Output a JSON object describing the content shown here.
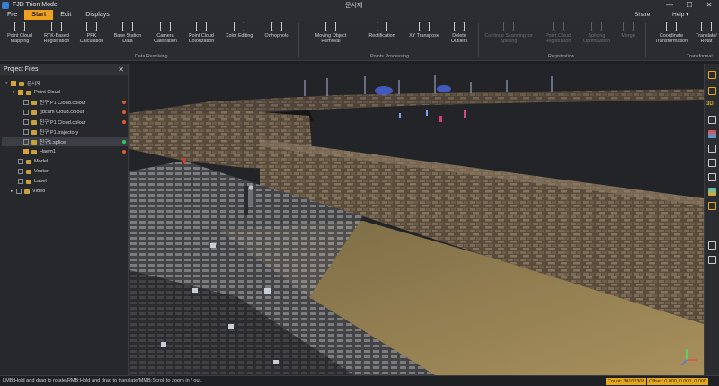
{
  "app": {
    "title": "FJD Trion Model",
    "document_title": "문서제"
  },
  "window_controls": {
    "minimize": "—",
    "maximize": "☐",
    "close": "✕"
  },
  "menu": {
    "items": [
      {
        "label": "File",
        "active": false
      },
      {
        "label": "Start",
        "active": true
      },
      {
        "label": "Edit",
        "active": false
      },
      {
        "label": "Displays",
        "active": false
      }
    ],
    "share": "Share",
    "help": "Help ▾"
  },
  "ribbon": {
    "buttons": [
      {
        "line1": "Point Cloud",
        "line2": "Mapping",
        "icon": "mapping-icon",
        "enabled": true
      },
      {
        "line1": "RTK-Based",
        "line2": "Registration",
        "icon": "rtk-icon",
        "enabled": true
      },
      {
        "line1": "PPK",
        "line2": "Calculation",
        "icon": "ppk-icon",
        "enabled": true
      },
      {
        "line1": "Base Station",
        "line2": "Data",
        "icon": "base-station-icon",
        "enabled": true
      },
      {
        "line1": "Camera",
        "line2": "Calibration",
        "icon": "camera-icon",
        "enabled": true
      },
      {
        "line1": "Point Cloud",
        "line2": "Colorization",
        "icon": "palette-icon",
        "enabled": true
      },
      {
        "line1": "Color Editing",
        "line2": "",
        "icon": "color-edit-icon",
        "enabled": true
      },
      {
        "line1": "Orthophoto",
        "line2": "",
        "icon": "orthophoto-icon",
        "enabled": true
      },
      {
        "line1": "Moving Object",
        "line2": "Removal",
        "icon": "moving-object-icon",
        "enabled": true
      },
      {
        "line1": "Rectification",
        "line2": "",
        "icon": "rectification-icon",
        "enabled": true
      },
      {
        "line1": "XY Transpose",
        "line2": "",
        "icon": "transpose-icon",
        "enabled": true
      },
      {
        "line1": "Delete",
        "line2": "Outliers",
        "icon": "delete-outliers-icon",
        "enabled": true
      },
      {
        "line1": "Continue Scanning for",
        "line2": "Splicing",
        "icon": "continue-scan-icon",
        "enabled": false
      },
      {
        "line1": "Point Cloud",
        "line2": "Registration",
        "icon": "registration-icon",
        "enabled": false
      },
      {
        "line1": "Splicing",
        "line2": "Optimization",
        "icon": "splicing-icon",
        "enabled": false
      },
      {
        "line1": "Merge",
        "line2": "",
        "icon": "merge-icon",
        "enabled": false
      },
      {
        "line1": "Coordinate",
        "line2": "Transformation",
        "icon": "coordinate-icon",
        "enabled": true
      },
      {
        "line1": "Translate/",
        "line2": "Rotat",
        "icon": "translate-rotate-icon",
        "enabled": true
      }
    ],
    "groups": [
      "Data Resolving",
      "Points Processing",
      "Registration",
      "Transformat"
    ]
  },
  "panel": {
    "title": "Project Files",
    "close": "✕",
    "tree": [
      {
        "label": "문서제",
        "checked": true,
        "expanded": true,
        "selected": false,
        "status": ""
      },
      {
        "label": "Point Cloud",
        "checked": true,
        "expanded": true,
        "selected": false,
        "status": ""
      },
      {
        "label": "친구 P1    Cloud.colour",
        "checked": false,
        "expanded": false,
        "selected": false,
        "status": "#e0582f"
      },
      {
        "label": "fjdcam    Cloud.colour",
        "checked": false,
        "expanded": false,
        "selected": false,
        "status": "#e0582f"
      },
      {
        "label": "친구 P1    Cloud.colour",
        "checked": false,
        "expanded": false,
        "selected": false,
        "status": "#e0582f"
      },
      {
        "label": "친구 P1.trajectory",
        "checked": false,
        "expanded": false,
        "selected": false,
        "status": ""
      },
      {
        "label": "친구1.splice",
        "checked": false,
        "expanded": false,
        "selected": true,
        "status": "#39c45a"
      },
      {
        "label": "Haem1",
        "checked": true,
        "expanded": false,
        "selected": false,
        "status": "#e0582f"
      },
      {
        "label": "Model",
        "checked": false,
        "expanded": false,
        "selected": false,
        "status": ""
      },
      {
        "label": "Vector",
        "checked": false,
        "expanded": false,
        "selected": false,
        "status": ""
      },
      {
        "label": "Label",
        "checked": false,
        "expanded": false,
        "selected": false,
        "status": ""
      },
      {
        "label": "Video",
        "checked": false,
        "expanded": true,
        "selected": false,
        "status": ""
      }
    ]
  },
  "right_tools": {
    "items": [
      {
        "icon": "layers-icon",
        "color": "#e6a81a"
      },
      {
        "icon": "folder-icon",
        "color": "#e6a81a"
      },
      {
        "icon": "3d-view-icon",
        "color": "#e6a81a",
        "label": "3D"
      },
      {
        "icon": "measure-icon",
        "color": "#c9ccd0"
      },
      {
        "icon": "palette-icon",
        "color": "#4aa3e8"
      },
      {
        "icon": "render-icon",
        "color": "#c9ccd0"
      },
      {
        "icon": "section-icon",
        "color": "#c9ccd0"
      },
      {
        "icon": "filter-icon",
        "color": "#c9ccd0"
      },
      {
        "icon": "gradient-icon",
        "color": "#4ac0d8"
      },
      {
        "icon": "box-icon",
        "color": "#e6a81a"
      },
      {
        "icon": "grid-icon",
        "color": "#c9ccd0"
      },
      {
        "icon": "crop-icon",
        "color": "#c9ccd0"
      }
    ]
  },
  "status": {
    "hint": "LMB:Hold and drag to rotate/RMB:Hold and drag to translate/MMB:Scroll to zoom in / out.",
    "count": "Count: 34102308",
    "offset": "Offset: 0.000, 0.000, 0.000"
  },
  "colors": {
    "accent": "#e6a81a",
    "background": "#1e1f22"
  }
}
